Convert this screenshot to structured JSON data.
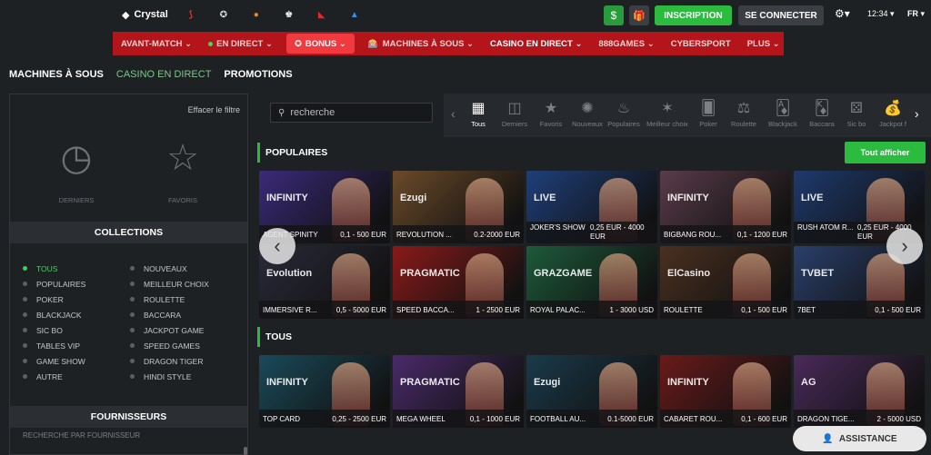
{
  "topbar": {
    "brand_label": "Crystal",
    "cta_register": "INSCRIPTION",
    "cta_login": "SE CONNECTER",
    "time": "12:34",
    "language": "FR"
  },
  "main_nav": [
    {
      "label": "AVANT-MATCH ⌄"
    },
    {
      "label": "EN DIRECT ⌄"
    },
    {
      "label": "BONUS ⌄"
    },
    {
      "label": "MACHINES À SOUS ⌄"
    },
    {
      "label": "CASINO EN DIRECT ⌄"
    },
    {
      "label": "888GAMES ⌄"
    },
    {
      "label": "CYBERSPORT"
    },
    {
      "label": "PLUS ⌄"
    }
  ],
  "sub_nav": [
    {
      "label": "MACHINES À SOUS"
    },
    {
      "label": "CASINO EN DIRECT"
    },
    {
      "label": "PROMOTIONS"
    }
  ],
  "sidebar": {
    "clear_filter": "Effacer le filtre",
    "recent_label": "DERNIERS",
    "favorites_label": "FAVORIS",
    "collections_title": "COLLECTIONS",
    "collections_left": [
      "TOUS",
      "POPULAIRES",
      "POKER",
      "BLACKJACK",
      "SIC BO",
      "TABLES VIP",
      "GAME SHOW",
      "AUTRE"
    ],
    "collections_right": [
      "NOUVEAUX",
      "MEILLEUR CHOIX",
      "ROULETTE",
      "BACCARA",
      "JACKPOT GAME",
      "SPEED GAMES",
      "DRAGON TIGER",
      "HINDI STYLE"
    ],
    "providers_title": "FOURNISSEURS",
    "providers_search": "RECHERCHE PAR FOURNISSEUR"
  },
  "search": {
    "placeholder": "recherche"
  },
  "categories": [
    "Tous",
    "Derniers",
    "Favoris",
    "Nouveaux",
    "Populaires",
    "Meilleur choix",
    "Poker",
    "Roulette",
    "Blackjack",
    "Baccara",
    "Sic bo",
    "Jackpot f"
  ],
  "sections": {
    "popular_title": "POPULAIRES",
    "show_all": "Tout afficher",
    "all_title": "TOUS"
  },
  "popular_games": [
    {
      "name": "AGENT SPINITY",
      "limits": "0,1 - 500 EUR",
      "brand": "INFINITY",
      "color": "#3b2a7a"
    },
    {
      "name": "REVOLUTION ...",
      "limits": "0.2-2000 EUR",
      "brand": "Ezugi",
      "color": "#6b4a2a"
    },
    {
      "name": "JOKER'S SHOW",
      "limits": "0,25 EUR - 4000 EUR",
      "brand": "LIVE",
      "color": "#1f3f7a"
    },
    {
      "name": "BIGBANG ROU...",
      "limits": "0,1 - 1200 EUR",
      "brand": "INFINITY",
      "color": "#5a3b4a"
    },
    {
      "name": "RUSH ATOM R...",
      "limits": "0,25 EUR - 4000 EUR",
      "brand": "LIVE",
      "color": "#1e3a6e"
    },
    {
      "name": "IMMERSIVE R...",
      "limits": "0,5 - 5000 EUR",
      "brand": "Evolution",
      "color": "#2a2a3a"
    },
    {
      "name": "SPEED BACCA...",
      "limits": "1 - 2500 EUR",
      "brand": "PRAGMATIC",
      "color": "#8a1a1a"
    },
    {
      "name": "ROYAL PALAC...",
      "limits": "1 - 3000 USD",
      "brand": "GRAZGAME",
      "color": "#1d5a3a"
    },
    {
      "name": "ROULETTE",
      "limits": "0,1 - 500 EUR",
      "brand": "ElCasino",
      "color": "#4a3020"
    },
    {
      "name": "7BET",
      "limits": "0,1 - 500 EUR",
      "brand": "TVBET",
      "color": "#2a3f6a"
    }
  ],
  "all_games": [
    {
      "name": "TOP CARD",
      "limits": "0,25 - 2500 EUR",
      "brand": "INFINITY",
      "color": "#1a4a5a"
    },
    {
      "name": "MEGA WHEEL",
      "limits": "0,1 - 1000 EUR",
      "brand": "PRAGMATIC",
      "color": "#4a2a6a"
    },
    {
      "name": "FOOTBALL AU...",
      "limits": "0.1-5000 EUR",
      "brand": "Ezugi",
      "color": "#1a3a4a"
    },
    {
      "name": "CABARET ROU...",
      "limits": "0,1 - 600 EUR",
      "brand": "INFINITY",
      "color": "#6a1a1a"
    },
    {
      "name": "DRAGON TIGE...",
      "limits": "2 - 5000 USD",
      "brand": "AG",
      "color": "#4a2a5a"
    }
  ],
  "assistance": "ASSISTANCE"
}
